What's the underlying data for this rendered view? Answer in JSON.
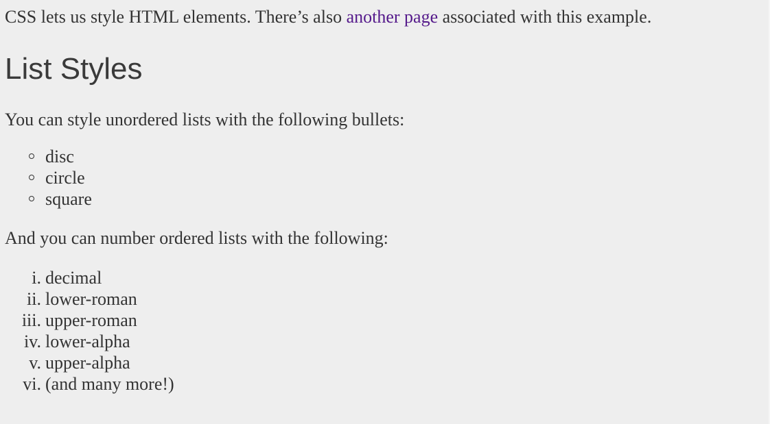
{
  "intro": {
    "text_before": "CSS lets us style HTML elements. There’s also ",
    "link_text": "another page",
    "text_after": " associated with this example."
  },
  "heading": "List Styles",
  "unordered_intro": "You can style unordered lists with the following bullets:",
  "bullets": [
    "disc",
    "circle",
    "square"
  ],
  "ordered_intro": "And you can number ordered lists with the following:",
  "ordered": [
    {
      "marker": "i.",
      "label": "decimal"
    },
    {
      "marker": "ii.",
      "label": "lower-roman"
    },
    {
      "marker": "iii.",
      "label": "upper-roman"
    },
    {
      "marker": "iv.",
      "label": "lower-alpha"
    },
    {
      "marker": "v.",
      "label": "upper-alpha"
    },
    {
      "marker": "vi.",
      "label": "(and many more!)"
    }
  ],
  "colors": {
    "background": "#eeeeee",
    "text": "#333333",
    "link_visited": "#551a8b"
  }
}
